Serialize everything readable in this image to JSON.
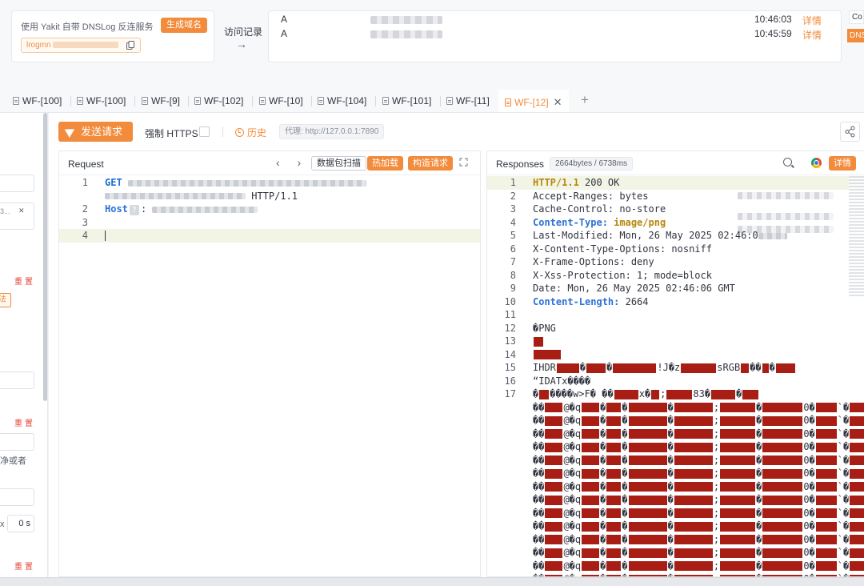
{
  "dnslog": {
    "hint": "使用 Yakit 自带 DNSLog 反连服务",
    "generate_label": "生成域名",
    "domain_prefix": "lrogmn"
  },
  "visit_records": {
    "label": "访问记录",
    "arrow": "→",
    "rows": [
      {
        "type": "A",
        "time": "10:46:03",
        "detail": "详情"
      },
      {
        "type": "A",
        "time": "10:45:59",
        "detail": "详情"
      }
    ]
  },
  "side_tabs": {
    "top": "Co",
    "bottom": "DNS"
  },
  "tabs": [
    {
      "label": "WF-[100]"
    },
    {
      "label": "WF-[100]"
    },
    {
      "label": "WF-[9]"
    },
    {
      "label": "WF-[102]"
    },
    {
      "label": "WF-[10]"
    },
    {
      "label": "WF-[104]"
    },
    {
      "label": "WF-[101]"
    },
    {
      "label": "WF-[11]"
    },
    {
      "label": "WF-[12]",
      "active": true
    }
  ],
  "tab_close": "✕",
  "tab_add": "+",
  "left_panel": {
    "reset": "重置",
    "tag": "法",
    "chip": "3...",
    "chip_close": "✕",
    "text1": "净或者",
    "text2_left": "x",
    "text2_right": "0 s"
  },
  "toolbar": {
    "send_label": "发送请求",
    "force_https": "强制 HTTPS",
    "history": "历史",
    "proxy": "代理: http://127.0.0.1:7890"
  },
  "request": {
    "title": "Request",
    "nav": "‹ ›",
    "scan_label": "数据包扫描",
    "hotload_label": "热加载",
    "build_label": "构造请求",
    "lines": {
      "l1_method": "GET",
      "l1b_proto": "HTTP/1.1",
      "l2_host": "Host",
      "l2_badge": "?"
    },
    "line_numbers": [
      "1",
      "2",
      "3",
      "4"
    ]
  },
  "response": {
    "title": "Responses",
    "meta": "2664bytes / 6738ms",
    "detail_label": "详情",
    "line_numbers": [
      "1",
      "2",
      "3",
      "4",
      "5",
      "6",
      "7",
      "8",
      "9",
      "10",
      "11",
      "12",
      "13",
      "14",
      "15",
      "16",
      "17"
    ],
    "lines": {
      "l1a": "HTTP/1.1",
      "l1b": "200 OK",
      "l2": "Accept-Ranges: bytes",
      "l3": "Cache-Control: no-store",
      "l4k": "Content-Type:",
      "l4v": "image/png",
      "l5": "Last-Modified: Mon, 26 May 2025 02:46:0",
      "l6": "X-Content-Type-Options: nosniff",
      "l7": "X-Frame-Options: deny",
      "l8": "X-Xss-Protection: 1; mode=block",
      "l9": "Date: Mon, 26 May 2025 02:46:06 GMT",
      "l10k": "Content-Length:",
      "l10v": "2664",
      "l12": "�PNG",
      "l15a": "IHDR",
      "l15b": "!J�z",
      "l15c": "sRGB",
      "l16": "“IDATx����",
      "l17a": "�",
      "l17b": "����w>F�",
      "l17c": "��",
      "l17d": "x�",
      "l17e": ";",
      "l17f": "83�",
      "wrap_a": "��",
      "wrap_b": "@�q",
      "wrap_c": ";"
    }
  },
  "colors": {
    "accent": "#f28b3b",
    "binary": "#a91e14",
    "keyword": "#1f6fd2"
  }
}
